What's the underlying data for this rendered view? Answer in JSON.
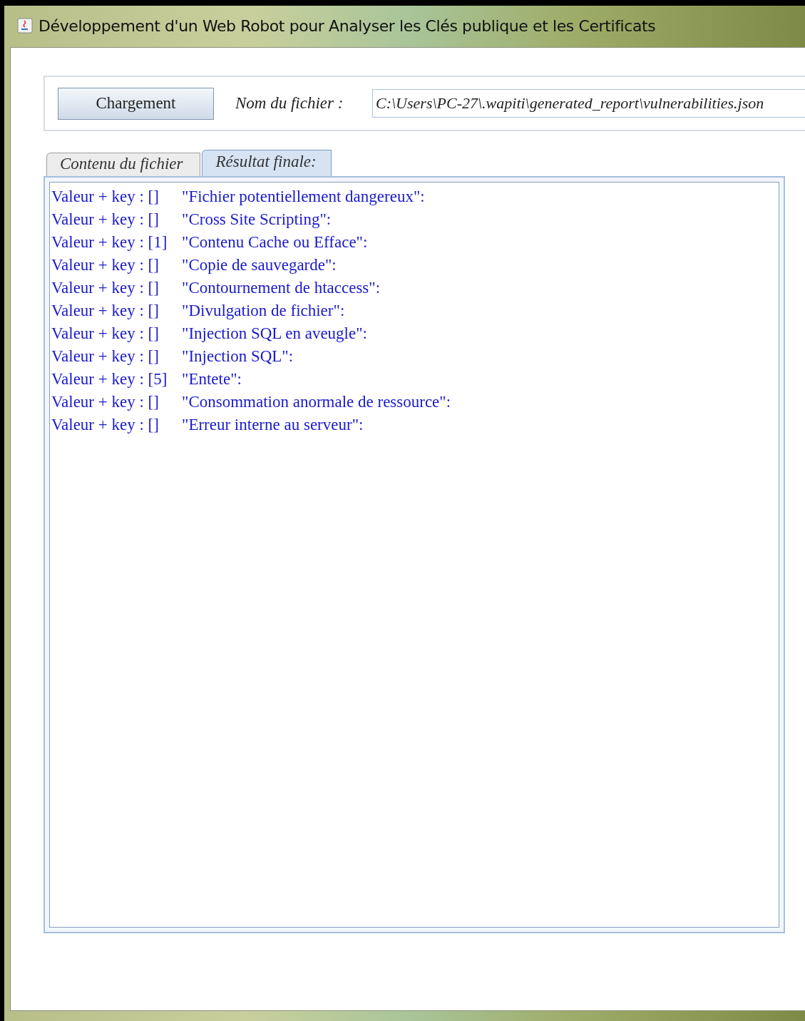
{
  "window": {
    "title": "Développement d'un Web Robot pour Analyser les Clés publique et les Certificats"
  },
  "toolbar": {
    "load_button": "Chargement",
    "file_label": "Nom du fichier :",
    "file_path": "C:\\Users\\PC-27\\.wapiti\\generated_report\\vulnerabilities.json"
  },
  "tabs": [
    {
      "label": "Contenu du fichier",
      "selected": false
    },
    {
      "label": "Résultat finale:",
      "selected": true
    }
  ],
  "lines": [
    {
      "prefix": "Valeur + key : []",
      "text": "\"Fichier potentiellement dangereux\":"
    },
    {
      "prefix": "Valeur + key : []",
      "text": "\"Cross Site Scripting\":"
    },
    {
      "prefix": "Valeur + key : [1]",
      "text": "\"Contenu Cache ou Efface\":"
    },
    {
      "prefix": "Valeur + key : []",
      "text": "\"Copie de sauvegarde\":"
    },
    {
      "prefix": "Valeur + key : []",
      "text": "\"Contournement de htaccess\":"
    },
    {
      "prefix": "Valeur + key : []",
      "text": "\"Divulgation de fichier\":"
    },
    {
      "prefix": "Valeur + key : []",
      "text": "\"Injection SQL en aveugle\":"
    },
    {
      "prefix": "Valeur + key : []",
      "text": "\"Injection SQL\":"
    },
    {
      "prefix": "Valeur + key : [5]",
      "text": "\"Entete\":"
    },
    {
      "prefix": "Valeur + key : []",
      "text": "\"Consommation anormale de ressource\":"
    },
    {
      "prefix": "Valeur + key : []",
      "text": "\"Erreur interne au serveur\":"
    }
  ]
}
